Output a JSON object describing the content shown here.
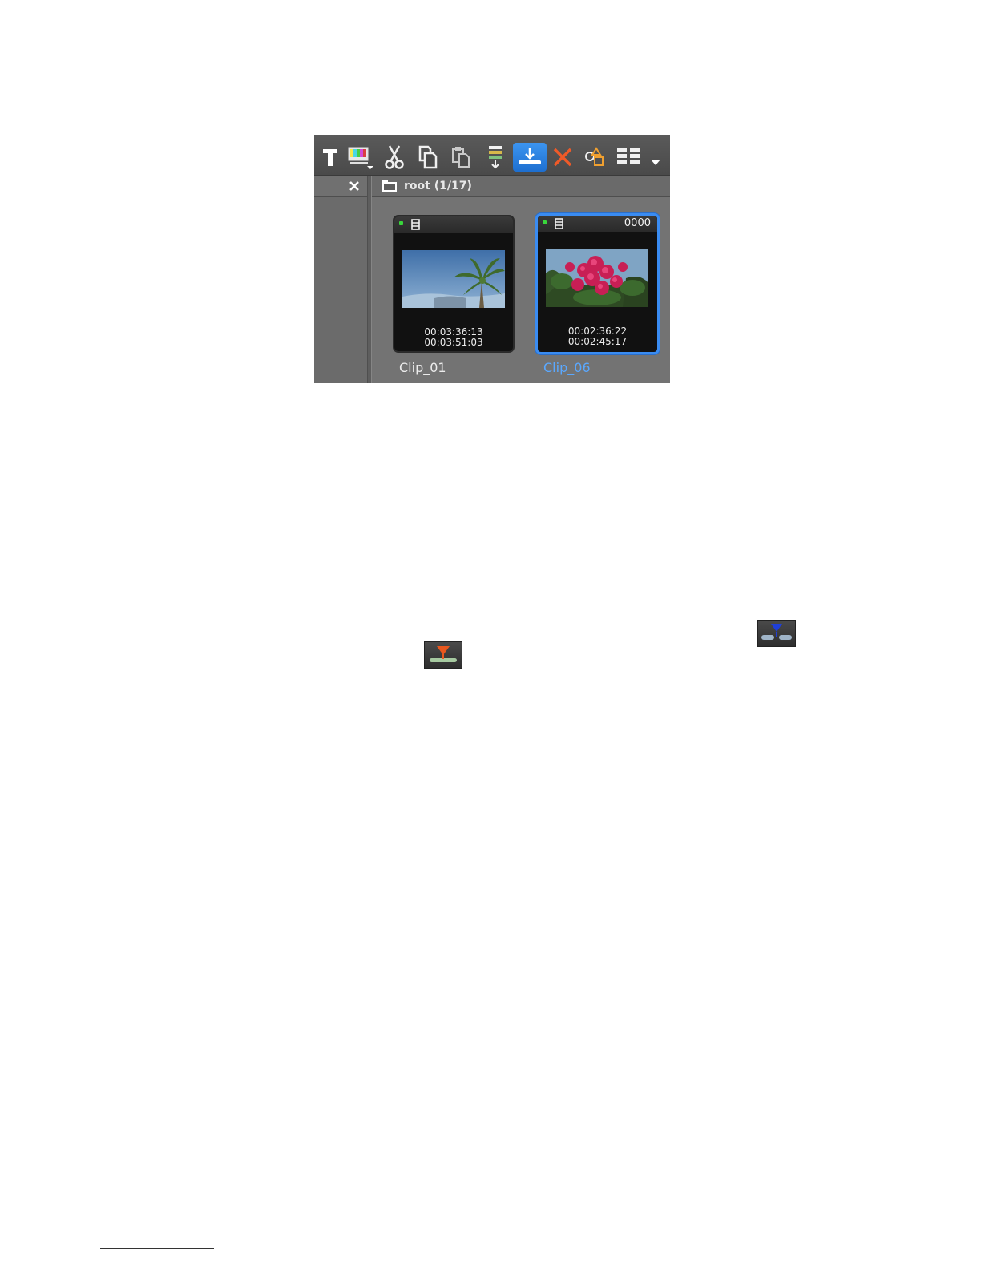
{
  "bin": {
    "folder_label": "root (1/17)",
    "toolbar_icons": [
      "title-icon",
      "color-bars-icon",
      "cut-icon",
      "copy-icon",
      "paste-icon",
      "insert-to-timeline-icon",
      "overwrite-to-timeline-icon",
      "delete-icon",
      "effects-icon",
      "view-toggle-icon",
      "more-dropdown-icon"
    ],
    "active_tool": "overwrite-to-timeline-icon",
    "clips": [
      {
        "name": "Clip_01",
        "count": "",
        "timecode_in": "00:03:36:13",
        "timecode_out": "00:03:51:03",
        "selected": false,
        "thumbnail": "palm-tree-sky"
      },
      {
        "name": "Clip_06",
        "count": "0000",
        "timecode_in": "00:02:36:22",
        "timecode_out": "00:02:45:17",
        "selected": true,
        "thumbnail": "pink-flowers"
      }
    ],
    "accent_color": "#3a8cf2",
    "status_color": "#39d63b"
  },
  "inline_icons": [
    "insert-to-timeline-icon",
    "overwrite-to-timeline-icon"
  ]
}
